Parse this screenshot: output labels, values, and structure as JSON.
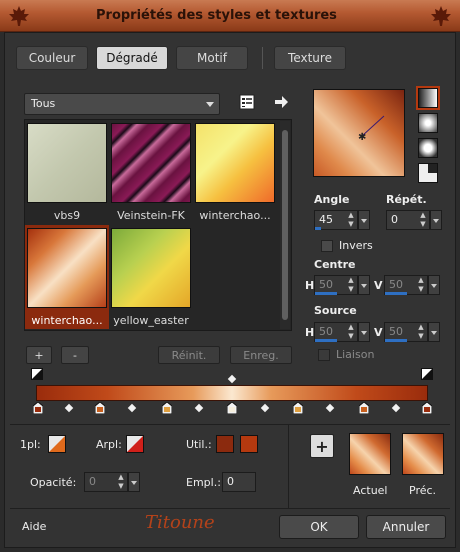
{
  "window": {
    "title": "Propriétés des styles et textures"
  },
  "tabs": [
    {
      "label": "Couleur"
    },
    {
      "label": "Dégradé"
    },
    {
      "label": "Motif"
    },
    {
      "label": "Texture"
    }
  ],
  "active_tab": "Dégradé",
  "category_select": {
    "value": "Tous"
  },
  "gradients": [
    {
      "label": "vbs9"
    },
    {
      "label": "Veinstein-FK"
    },
    {
      "label": "winterchao..."
    },
    {
      "label": "winterchao...",
      "selected": true
    },
    {
      "label": "yellow_easter"
    }
  ],
  "gallery_buttons": {
    "add": "+",
    "remove": "-",
    "reset": "Réinit.",
    "save": "Enreg."
  },
  "gradient_settings": {
    "angle_label": "Angle",
    "angle_value": "45",
    "repeat_label": "Répét.",
    "repeat_value": "0",
    "invert_label": "Invers",
    "center_label": "Centre",
    "center_h_label": "H",
    "center_h_value": "50",
    "center_v_label": "V",
    "center_v_value": "50",
    "source_label": "Source",
    "source_h_label": "H",
    "source_h_value": "50",
    "source_v_label": "V",
    "source_v_value": "50",
    "link_label": "Liaison"
  },
  "stops_panel": {
    "first_label": "1pl:",
    "arpl_label": "Arpl:",
    "util_label": "Util.:",
    "opacity_label": "Opacité:",
    "opacity_value": "0",
    "empl_label": "Empl.:",
    "empl_value": "0"
  },
  "preview": {
    "current_label": "Actuel",
    "previous_label": "Préc."
  },
  "footer": {
    "help_label": "Aide",
    "signature": "Titoune",
    "ok_label": "OK",
    "cancel_label": "Annuler"
  },
  "colors": {
    "accent": "#b5390f",
    "stop_dark": "#9a2c0c",
    "stop_mid": "#c8601e",
    "stop_light": "#e0a040",
    "stop_pale": "#f5eedd",
    "util_1": "#8b2a0e",
    "util_2": "#b5390f"
  }
}
